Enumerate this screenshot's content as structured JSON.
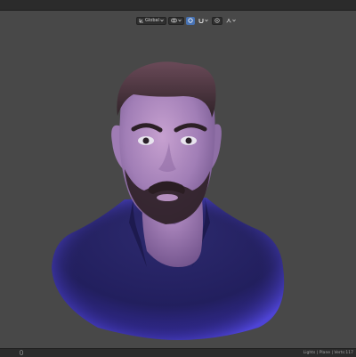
{
  "viewport_header": {
    "orientation_label": "Global",
    "icons": [
      "transform-orientation-icon",
      "pivot-icon",
      "snap-icon",
      "snap-magnet-icon",
      "proportional-editing-icon",
      "falloff-icon"
    ]
  },
  "viewport": {
    "subject": "sculpted-bust-icon"
  },
  "status_bar": {
    "stats_text": "Lights | Plane | Verts:117"
  },
  "colors": {
    "viewport_bg": "#484848",
    "topbar_bg": "#2b2b2b",
    "active_blue": "#4772b3"
  }
}
